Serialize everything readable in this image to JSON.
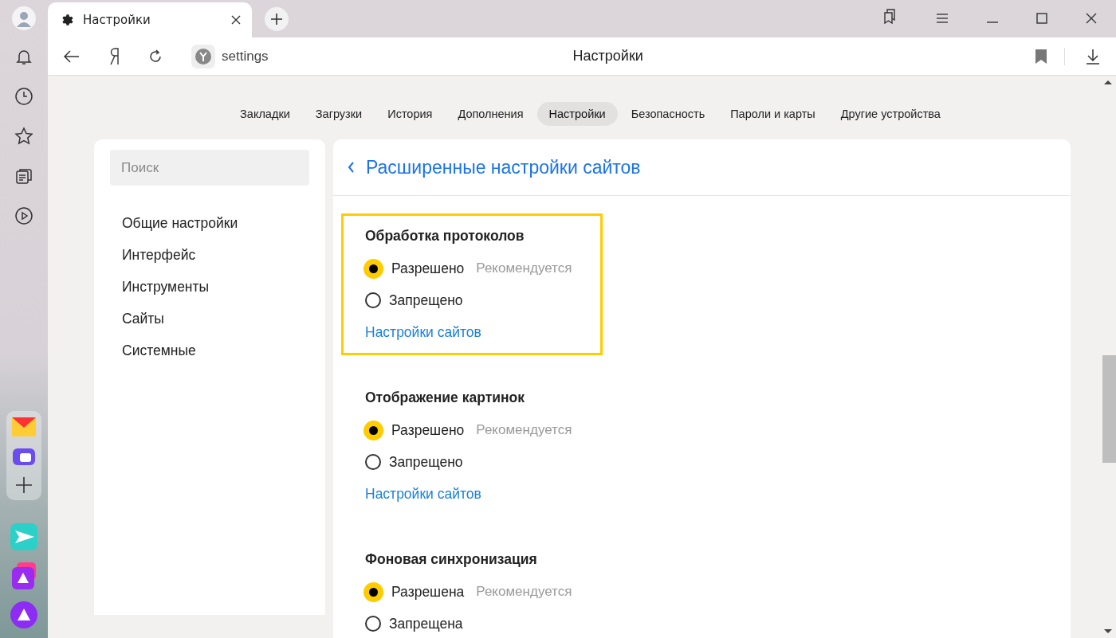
{
  "tab": {
    "title": "Настройки"
  },
  "address": {
    "url": "settings",
    "page_title": "Настройки"
  },
  "nav_tabs": [
    {
      "label": "Закладки",
      "selected": false
    },
    {
      "label": "Загрузки",
      "selected": false
    },
    {
      "label": "История",
      "selected": false
    },
    {
      "label": "Дополнения",
      "selected": false
    },
    {
      "label": "Настройки",
      "selected": true
    },
    {
      "label": "Безопасность",
      "selected": false
    },
    {
      "label": "Пароли и карты",
      "selected": false
    },
    {
      "label": "Другие устройства",
      "selected": false
    }
  ],
  "search": {
    "placeholder": "Поиск"
  },
  "menu": [
    {
      "label": "Общие настройки"
    },
    {
      "label": "Интерфейс"
    },
    {
      "label": "Инструменты"
    },
    {
      "label": "Сайты"
    },
    {
      "label": "Системные"
    }
  ],
  "panel": {
    "title": "Расширенные настройки сайтов"
  },
  "sections": [
    {
      "title": "Обработка протоколов",
      "highlighted": true,
      "options": [
        {
          "label": "Разрешено",
          "note": "Рекомендуется",
          "selected": true
        },
        {
          "label": "Запрещено",
          "selected": false
        }
      ],
      "link": "Настройки сайтов"
    },
    {
      "title": "Отображение картинок",
      "highlighted": false,
      "options": [
        {
          "label": "Разрешено",
          "note": "Рекомендуется",
          "selected": true
        },
        {
          "label": "Запрещено",
          "selected": false
        }
      ],
      "link": "Настройки сайтов"
    },
    {
      "title": "Фоновая синхронизация",
      "highlighted": false,
      "options": [
        {
          "label": "Разрешена",
          "note": "Рекомендуется",
          "selected": true
        },
        {
          "label": "Запрещена",
          "selected": false
        }
      ]
    }
  ]
}
